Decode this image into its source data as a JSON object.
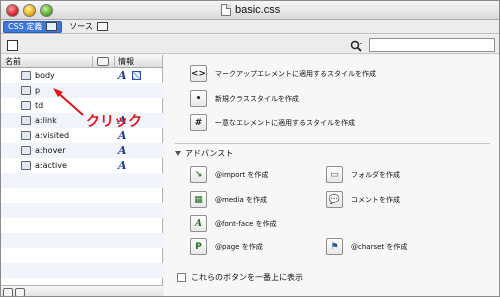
{
  "window": {
    "title": "basic.css"
  },
  "tabs": [
    {
      "label": "CSS 定義",
      "active": true
    },
    {
      "label": "ソース",
      "active": false
    }
  ],
  "search": {
    "value": "",
    "placeholder": ""
  },
  "columns": {
    "name": "名前",
    "info": "情報"
  },
  "rules": [
    {
      "label": "body",
      "info_icons": [
        "font-a-icon",
        "grid-icon"
      ]
    },
    {
      "label": "p",
      "info_icons": []
    },
    {
      "label": "td",
      "info_icons": []
    },
    {
      "label": "a:link",
      "info_icons": [
        "font-a-icon"
      ]
    },
    {
      "label": "a:visited",
      "info_icons": [
        "font-a-icon"
      ]
    },
    {
      "label": "a:hover",
      "info_icons": [
        "font-a-icon"
      ]
    },
    {
      "label": "a:active",
      "info_icons": [
        "font-a-icon"
      ]
    }
  ],
  "actions": {
    "markup": "マークアップエレメントに適用するスタイルを作成",
    "new_class": "新規クラススタイルを作成",
    "unique": "一意なエレメントに適用するスタイルを作成"
  },
  "advanced": {
    "label": "アドバンスト",
    "items": [
      {
        "label": "@import を作成",
        "icon": "import-icon"
      },
      {
        "label": "フォルダを作成",
        "icon": "folder-icon"
      },
      {
        "label": "@media を作成",
        "icon": "media-icon"
      },
      {
        "label": "コメントを作成",
        "icon": "comment-icon"
      },
      {
        "label": "@font-face を作成",
        "icon": "fontface-icon"
      },
      {
        "label": "@page を作成",
        "icon": "page-icon"
      },
      {
        "label": "@charset を作成",
        "icon": "charset-icon"
      }
    ]
  },
  "checkbox": {
    "label": "これらのボタンを一番上に表示",
    "checked": false
  },
  "callout": {
    "label": "クリック"
  },
  "colors": {
    "accent": "#3d78d8",
    "annotation": "#e01515"
  }
}
